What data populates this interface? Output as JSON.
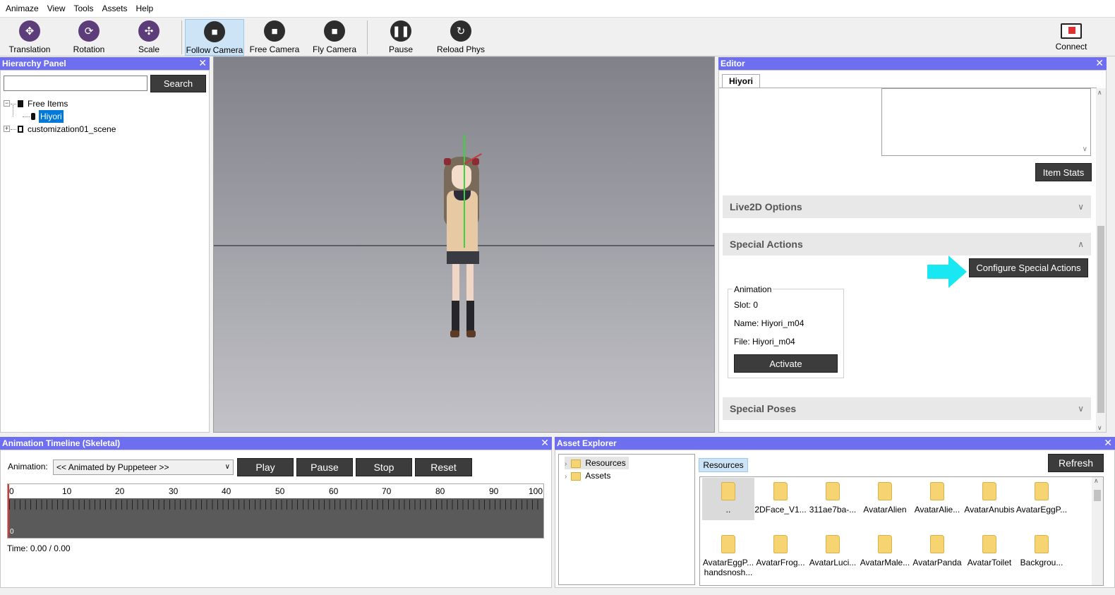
{
  "menu": [
    "Animaze",
    "View",
    "Tools",
    "Assets",
    "Help"
  ],
  "toolbar": {
    "translation": "Translation",
    "rotation": "Rotation",
    "scale": "Scale",
    "follow_camera": "Follow Camera",
    "free_camera": "Free Camera",
    "fly_camera": "Fly Camera",
    "pause": "Pause",
    "reload_phys": "Reload Phys",
    "connect": "Connect"
  },
  "hierarchy": {
    "title": "Hierarchy Panel",
    "search_button": "Search",
    "search_value": "",
    "tree": [
      "Free Items",
      "Hiyori",
      "customization01_scene"
    ]
  },
  "editor": {
    "title": "Editor",
    "tab": "Hiyori",
    "item_stats": "Item Stats",
    "live2d": "Live2D Options",
    "special_actions": "Special Actions",
    "configure": "Configure Special Actions",
    "animation_legend": "Animation",
    "slot": "Slot: 0",
    "name": "Name: Hiyori_m04",
    "file": "File: Hiyori_m04",
    "activate": "Activate",
    "special_poses": "Special Poses"
  },
  "timeline": {
    "title": "Animation Timeline (Skeletal)",
    "animation_label": "Animation:",
    "animation_value": "<< Animated by Puppeteer >>",
    "play": "Play",
    "pause": "Pause",
    "stop": "Stop",
    "reset": "Reset",
    "ruler": [
      "0",
      "10",
      "20",
      "30",
      "40",
      "50",
      "60",
      "70",
      "80",
      "90",
      "100"
    ],
    "zero": "0",
    "time": "Time: 0.00 / 0.00"
  },
  "assets": {
    "title": "Asset Explorer",
    "tree": [
      "Resources",
      "Assets"
    ],
    "breadcrumb": "Resources",
    "refresh": "Refresh",
    "items": [
      {
        "name": ".."
      },
      {
        "name": "2DFace_V1..."
      },
      {
        "name": "311ae7ba-..."
      },
      {
        "name": "AvatarAlien"
      },
      {
        "name": "AvatarAlie..."
      },
      {
        "name": "AvatarAnubis"
      },
      {
        "name": "AvatarEggP..."
      },
      {
        "name": "AvatarEggP...",
        "name2": "handsnosh..."
      },
      {
        "name": "AvatarFrog..."
      },
      {
        "name": "AvatarLuci..."
      },
      {
        "name": "AvatarMale..."
      },
      {
        "name": "AvatarPanda"
      },
      {
        "name": "AvatarToilet"
      },
      {
        "name": "Backgrou..."
      }
    ]
  },
  "colors": {
    "panel_header": "#6e6ef0",
    "accent_arrow": "#19e8f2",
    "dark_button": "#3c3c3c"
  }
}
